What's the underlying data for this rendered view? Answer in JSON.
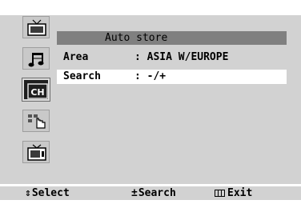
{
  "menu": {
    "title": "Auto store",
    "rows": [
      {
        "label": "Area",
        "value": ": ASIA W/EUROPE",
        "selected": false
      },
      {
        "label": "Search",
        "value": ": -/+",
        "selected": true
      }
    ]
  },
  "rail": {
    "icons": [
      {
        "name": "tv-picture-icon",
        "active": false
      },
      {
        "name": "sound-note-icon",
        "active": false
      },
      {
        "name": "channel-icon",
        "label": "CH",
        "active": true
      },
      {
        "name": "setup-hand-icon",
        "active": false
      },
      {
        "name": "input-tv-icon",
        "active": false
      }
    ]
  },
  "help": {
    "select_glyph": "⇕",
    "select_label": "Select",
    "search_glyph": "±",
    "search_label": "Search",
    "exit_label": "Exit"
  },
  "colors": {
    "panel": "#d2d2d2",
    "title_bar": "#808080",
    "highlight": "#ffffff",
    "active_icon": "#1f1f1f"
  }
}
